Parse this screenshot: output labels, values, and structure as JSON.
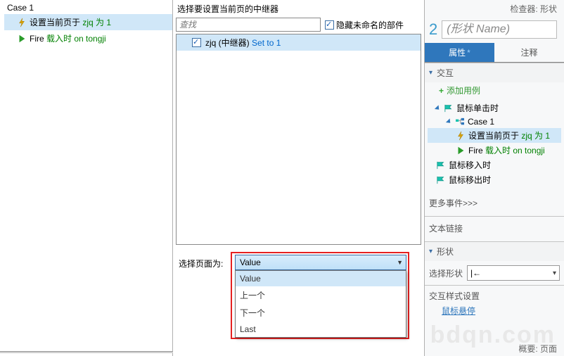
{
  "left": {
    "case_label": "Case 1",
    "actions": [
      {
        "pre": "设置当前页于 ",
        "link": "zjq 为 1"
      },
      {
        "pre": "Fire ",
        "link": "载入时 on tongji"
      }
    ]
  },
  "mid": {
    "title": "选择要设置当前页的中继器",
    "search_placeholder": "查找",
    "hide_unnamed": "隐藏未命名的部件",
    "list_item": {
      "pre": "zjq (中继器) ",
      "link": "Set to 1"
    },
    "select_page_label": "选择页面为:",
    "dropdown_selected": "Value",
    "dropdown_options": [
      "Value",
      "上一个",
      "下一个",
      "Last"
    ]
  },
  "right": {
    "inspector_label": "检查器: 形状",
    "number": "2",
    "shape_name_placeholder": "(形状 Name)",
    "tabs": {
      "props": "属性",
      "notes": "注释"
    },
    "section_interaction": "交互",
    "add_case": "添加用例",
    "tree": {
      "mouse_click": "鼠标单击时",
      "case1": "Case 1",
      "set_page": {
        "pre": "设置当前页于 ",
        "link": "zjq 为 1"
      },
      "fire": {
        "pre": "Fire ",
        "link": "载入时 on tongji"
      },
      "mouse_in": "鼠标移入时",
      "mouse_out": "鼠标移出时"
    },
    "more_events": "更多事件>>>",
    "text_link": "文本链接",
    "shape_section": "形状",
    "select_shape_label": "选择形状",
    "shape_glyph": "|←",
    "inter_style": "交互样式设置",
    "hover": "鼠标悬停",
    "footer": "概要: 页面"
  },
  "watermark": "bdqn.com"
}
